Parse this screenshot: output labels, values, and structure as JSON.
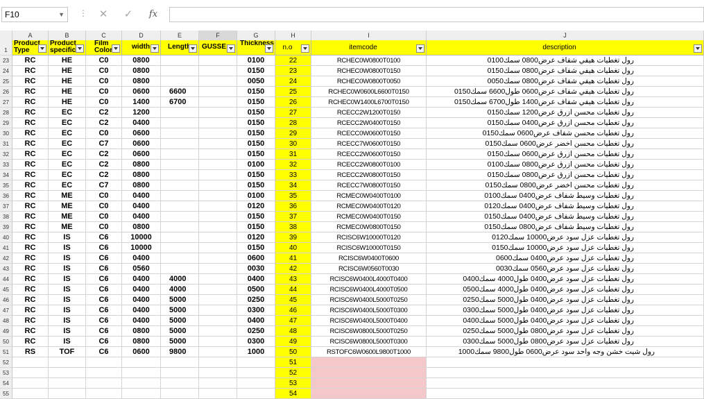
{
  "formula_bar": {
    "name_box": "F10",
    "cancel_icon": "✕",
    "enter_icon": "✓",
    "fx_label": "fx",
    "formula": ""
  },
  "columns": [
    "A",
    "B",
    "C",
    "D",
    "E",
    "F",
    "G",
    "H",
    "I",
    "J"
  ],
  "header_row_number": "1",
  "headers": {
    "A": "Product Type",
    "B": "Product specific",
    "C": "Film Color",
    "D": "width",
    "E": "Length",
    "F": "GUSSE",
    "G": "Thickness",
    "H": "n.o",
    "I": "itemcode",
    "J": "description"
  },
  "rows": [
    {
      "n": "23",
      "a": "RC",
      "b": "HE",
      "c": "C0",
      "d": "0800",
      "e": "",
      "g": "0100",
      "h": "22",
      "i": "RCHEC0W0800T0100",
      "j": "رول تغطيات هيفي شفاف عرض0800  سمك0100"
    },
    {
      "n": "24",
      "a": "RC",
      "b": "HE",
      "c": "C0",
      "d": "0800",
      "e": "",
      "g": "0150",
      "h": "23",
      "i": "RCHEC0W0800T0150",
      "j": "رول تغطيات هيفي شفاف عرض0800  سمك0150"
    },
    {
      "n": "25",
      "a": "RC",
      "b": "HE",
      "c": "C0",
      "d": "0800",
      "e": "",
      "g": "0050",
      "h": "24",
      "i": "RCHEC0W0800T0050",
      "j": "رول تغطيات هيفي شفاف عرض0800  سمك0050"
    },
    {
      "n": "26",
      "a": "RC",
      "b": "HE",
      "c": "C0",
      "d": "0600",
      "e": "6600",
      "g": "0150",
      "h": "25",
      "i": "RCHEC0W0600L6600T0150",
      "j": "رول تغطيات هيفي شفاف عرض0600 طول6600 سمك0150"
    },
    {
      "n": "27",
      "a": "RC",
      "b": "HE",
      "c": "C0",
      "d": "1400",
      "e": "6700",
      "g": "0150",
      "h": "26",
      "i": "RCHEC0W1400L6700T0150",
      "j": "رول تغطيات هيفي شفاف عرض1400 طول6700 سمك0150"
    },
    {
      "n": "28",
      "a": "RC",
      "b": "EC",
      "c": "C2",
      "d": "1200",
      "e": "",
      "g": "0150",
      "h": "27",
      "i": "RCECC2W1200T0150",
      "j": "رول تغطيات محسن ازرق عرض1200  سمك0150"
    },
    {
      "n": "29",
      "a": "RC",
      "b": "EC",
      "c": "C2",
      "d": "0400",
      "e": "",
      "g": "0150",
      "h": "28",
      "i": "RCECC2W0400T0150",
      "j": "رول تغطيات محسن ازرق عرض0400  سمك0150"
    },
    {
      "n": "30",
      "a": "RC",
      "b": "EC",
      "c": "C0",
      "d": "0600",
      "e": "",
      "g": "0150",
      "h": "29",
      "i": "RCECC0W0600T0150",
      "j": "رول تغطيات محسن شفاف عرض0600  سمك0150"
    },
    {
      "n": "31",
      "a": "RC",
      "b": "EC",
      "c": "C7",
      "d": "0600",
      "e": "",
      "g": "0150",
      "h": "30",
      "i": "RCECC7W0600T0150",
      "j": "رول تغطيات محسن اخضر عرض0600  سمك0150"
    },
    {
      "n": "32",
      "a": "RC",
      "b": "EC",
      "c": "C2",
      "d": "0600",
      "e": "",
      "g": "0150",
      "h": "31",
      "i": "RCECC2W0600T0150",
      "j": "رول تغطيات محسن ازرق عرض0600  سمك0150"
    },
    {
      "n": "33",
      "a": "RC",
      "b": "EC",
      "c": "C2",
      "d": "0800",
      "e": "",
      "g": "0100",
      "h": "32",
      "i": "RCECC2W0800T0100",
      "j": "رول تغطيات محسن ازرق عرض0800  سمك0100"
    },
    {
      "n": "34",
      "a": "RC",
      "b": "EC",
      "c": "C2",
      "d": "0800",
      "e": "",
      "g": "0150",
      "h": "33",
      "i": "RCECC2W0800T0150",
      "j": "رول تغطيات محسن ازرق عرض0800  سمك0150"
    },
    {
      "n": "35",
      "a": "RC",
      "b": "EC",
      "c": "C7",
      "d": "0800",
      "e": "",
      "g": "0150",
      "h": "34",
      "i": "RCECC7W0800T0150",
      "j": "رول تغطيات محسن اخضر عرض0800  سمك0150"
    },
    {
      "n": "36",
      "a": "RC",
      "b": "ME",
      "c": "C0",
      "d": "0400",
      "e": "",
      "g": "0100",
      "h": "35",
      "i": "RCMEC0W0400T0100",
      "j": "رول تغطيات وسيط شفاف عرض0400  سمك0100"
    },
    {
      "n": "37",
      "a": "RC",
      "b": "ME",
      "c": "C0",
      "d": "0400",
      "e": "",
      "g": "0120",
      "h": "36",
      "i": "RCMEC0W0400T0120",
      "j": "رول تغطيات وسيط شفاف عرض0400  سمك0120"
    },
    {
      "n": "38",
      "a": "RC",
      "b": "ME",
      "c": "C0",
      "d": "0400",
      "e": "",
      "g": "0150",
      "h": "37",
      "i": "RCMEC0W0400T0150",
      "j": "رول تغطيات وسيط شفاف عرض0400  سمك0150"
    },
    {
      "n": "39",
      "a": "RC",
      "b": "ME",
      "c": "C0",
      "d": "0800",
      "e": "",
      "g": "0150",
      "h": "38",
      "i": "RCMEC0W0800T0150",
      "j": "رول تغطيات وسيط شفاف عرض0800  سمك0150"
    },
    {
      "n": "40",
      "a": "RC",
      "b": "IS",
      "c": "C6",
      "d": "10000",
      "e": "",
      "g": "0120",
      "h": "39",
      "i": "RCISC6W10000T0120",
      "j": "رول تغطيات عزل سود عرض10000  سمك0120"
    },
    {
      "n": "41",
      "a": "RC",
      "b": "IS",
      "c": "C6",
      "d": "10000",
      "e": "",
      "g": "0150",
      "h": "40",
      "i": "RCISC6W10000T0150",
      "j": "رول تغطيات عزل سود عرض10000  سمك0150"
    },
    {
      "n": "42",
      "a": "RC",
      "b": "IS",
      "c": "C6",
      "d": "0400",
      "e": "",
      "g": "0600",
      "h": "41",
      "i": "RCISC6W0400T0600",
      "j": "رول تغطيات عزل سود عرض0400  سمك0600"
    },
    {
      "n": "43",
      "a": "RC",
      "b": "IS",
      "c": "C6",
      "d": "0560",
      "e": "",
      "g": "0030",
      "h": "42",
      "i": "RCISC6W0560T0030",
      "j": "رول تغطيات عزل سود عرض0560  سمك0030"
    },
    {
      "n": "44",
      "a": "RC",
      "b": "IS",
      "c": "C6",
      "d": "0400",
      "e": "4000",
      "g": "0400",
      "h": "43",
      "i": "RCISC6W0400L4000T0400",
      "j": "رول تغطيات عزل سود عرض0400 طول4000 سمك0400"
    },
    {
      "n": "45",
      "a": "RC",
      "b": "IS",
      "c": "C6",
      "d": "0400",
      "e": "4000",
      "g": "0500",
      "h": "44",
      "i": "RCISC6W0400L4000T0500",
      "j": "رول تغطيات عزل سود عرض0400 طول4000 سمك0500"
    },
    {
      "n": "46",
      "a": "RC",
      "b": "IS",
      "c": "C6",
      "d": "0400",
      "e": "5000",
      "g": "0250",
      "h": "45",
      "i": "RCISC6W0400L5000T0250",
      "j": "رول تغطيات عزل سود عرض0400 طول5000 سمك0250"
    },
    {
      "n": "47",
      "a": "RC",
      "b": "IS",
      "c": "C6",
      "d": "0400",
      "e": "5000",
      "g": "0300",
      "h": "46",
      "i": "RCISC6W0400L5000T0300",
      "j": "رول تغطيات عزل سود عرض0400 طول5000 سمك0300"
    },
    {
      "n": "48",
      "a": "RC",
      "b": "IS",
      "c": "C6",
      "d": "0400",
      "e": "5000",
      "g": "0400",
      "h": "47",
      "i": "RCISC6W0400L5000T0400",
      "j": "رول تغطيات عزل سود عرض0400 طول5000 سمك0400"
    },
    {
      "n": "49",
      "a": "RC",
      "b": "IS",
      "c": "C6",
      "d": "0800",
      "e": "5000",
      "g": "0250",
      "h": "48",
      "i": "RCISC6W0800L5000T0250",
      "j": "رول تغطيات عزل سود عرض0800 طول5000 سمك0250"
    },
    {
      "n": "50",
      "a": "RC",
      "b": "IS",
      "c": "C6",
      "d": "0800",
      "e": "5000",
      "g": "0300",
      "h": "49",
      "i": "RCISC6W0800L5000T0300",
      "j": "رول تغطيات عزل سود عرض0800 طول5000 سمك0300"
    },
    {
      "n": "51",
      "a": "RS",
      "b": "TOF",
      "c": "C6",
      "d": "0600",
      "e": "9800",
      "g": "1000",
      "h": "50",
      "i": "RSTOFC6W0600L9800T1000",
      "j": "رول شيت خشن وجه واحد سود عرض0600 طول9800 سمك1000"
    },
    {
      "n": "52",
      "a": "",
      "b": "",
      "c": "",
      "d": "",
      "e": "",
      "g": "",
      "h": "51",
      "i": "",
      "j": ""
    },
    {
      "n": "53",
      "a": "",
      "b": "",
      "c": "",
      "d": "",
      "e": "",
      "g": "",
      "h": "52",
      "i": "",
      "j": ""
    },
    {
      "n": "54",
      "a": "",
      "b": "",
      "c": "",
      "d": "",
      "e": "",
      "g": "",
      "h": "53",
      "i": "",
      "j": ""
    },
    {
      "n": "55",
      "a": "",
      "b": "",
      "c": "",
      "d": "",
      "e": "",
      "g": "",
      "h": "54",
      "i": "",
      "j": ""
    }
  ],
  "colors": {
    "header_fill": "#ffff00",
    "empty_code_fill": "#f4c7cb",
    "chrome": "#efefef"
  }
}
